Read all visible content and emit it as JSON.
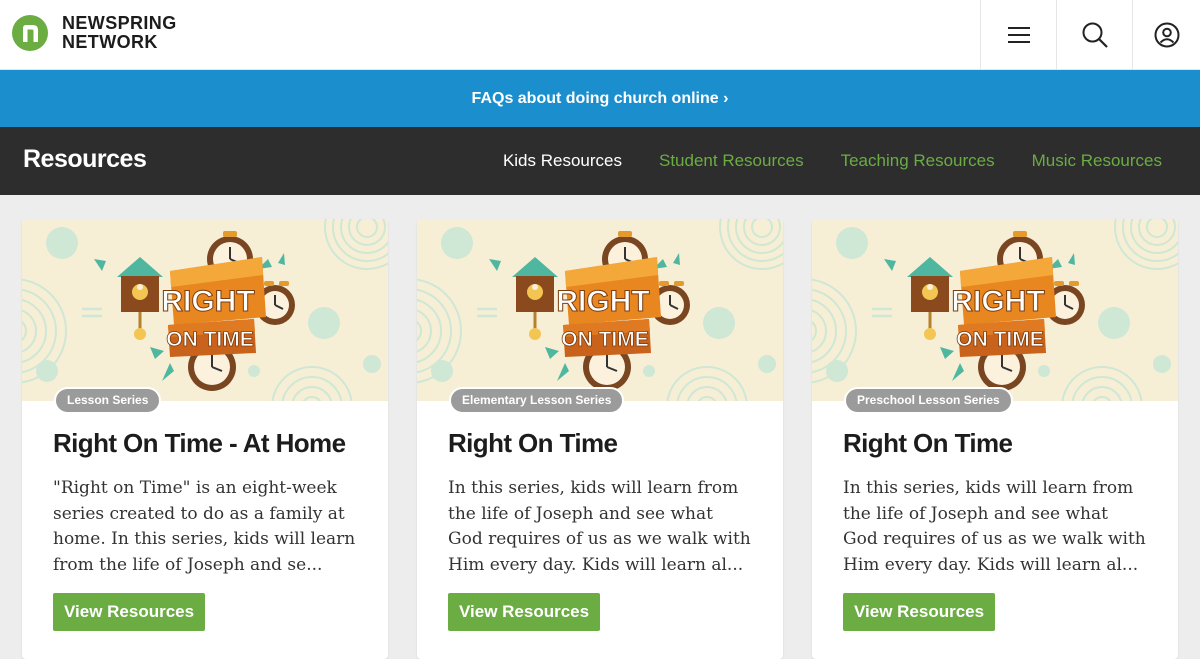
{
  "header": {
    "logo_line1": "NEWSPRING",
    "logo_line2": "NETWORK",
    "icons": [
      "menu-icon",
      "search-icon",
      "user-icon"
    ]
  },
  "banner": {
    "text": "FAQs about doing church online ›"
  },
  "subnav": {
    "title": "Resources",
    "links": [
      {
        "label": "Kids Resources",
        "active": true
      },
      {
        "label": "Student Resources",
        "active": false
      },
      {
        "label": "Teaching Resources",
        "active": false
      },
      {
        "label": "Music Resources",
        "active": false
      }
    ]
  },
  "cards": [
    {
      "image_text_line1": "RIGHT",
      "image_text_line2": "ON TIME",
      "badge": "Lesson Series",
      "title": "Right On Time - At Home",
      "description": "\"Right on Time\" is an eight-week series created to do as a family at home. In this series, kids will learn from the life of Joseph and se...",
      "button": "View Resources"
    },
    {
      "image_text_line1": "RIGHT",
      "image_text_line2": "ON TIME",
      "badge": "Elementary Lesson Series",
      "title": "Right On Time",
      "description": "In this series, kids will learn from the life of Joseph and see what God requires of us as we walk with Him every day. Kids will learn al...",
      "button": "View Resources"
    },
    {
      "image_text_line1": "RIGHT",
      "image_text_line2": "ON TIME",
      "badge": "Preschool Lesson Series",
      "title": "Right On Time",
      "description": "In this series, kids will learn from the life of Joseph and see what God requires of us as we walk with Him every day. Kids will learn al...",
      "button": "View Resources"
    }
  ],
  "colors": {
    "brand_green": "#6bac43",
    "banner_blue": "#1b8fcd",
    "subnav_dark": "#2d2d2d",
    "image_bg": "#f6efd6",
    "badge_gray": "#9b9b9b"
  }
}
